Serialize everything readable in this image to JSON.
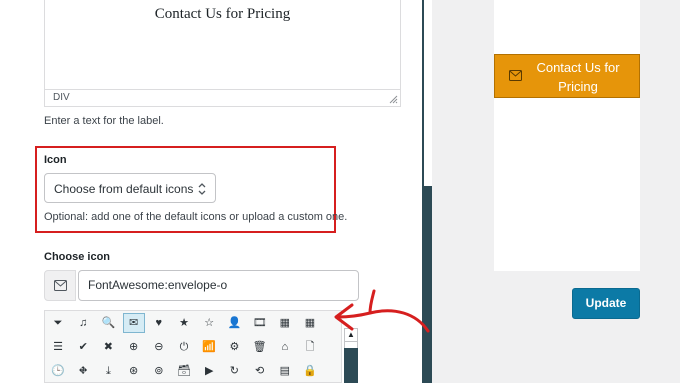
{
  "label_preview": {
    "text": "Contact Us for Pricing",
    "element_path": "DIV"
  },
  "label_help": "Enter a text for the label.",
  "icon_section": {
    "title": "Icon",
    "select_value": "Choose from default icons",
    "help": "Optional: add one of the default icons or upload a custom one."
  },
  "choose_icon": {
    "title": "Choose icon",
    "input_value": "FontAwesome:envelope-o",
    "prefix_icon": "envelope-o-icon"
  },
  "icon_grid": {
    "rows": [
      [
        "filter",
        "music",
        "search",
        "envelope-o",
        "heart",
        "star",
        "star-o",
        "user",
        "film",
        "th-large",
        "th"
      ],
      [
        "th-list",
        "check",
        "times",
        "search-plus",
        "search-minus",
        "power-off",
        "signal",
        "cog",
        "trash-o",
        "home",
        "file-o"
      ],
      [
        "clock-o",
        "road",
        "download",
        "arrow-circle-o-down",
        "arrow-circle-o-up",
        "inbox",
        "play-circle-o",
        "repeat",
        "refresh",
        "list-alt",
        "lock"
      ]
    ],
    "glyphs": [
      [
        "⏷",
        "♫",
        "🔍",
        "✉",
        "♥",
        "★",
        "☆",
        "👤",
        "🎞",
        "▦",
        "▦"
      ],
      [
        "☰",
        "✔",
        "✖",
        "⊕",
        "⊖",
        "⏻",
        "📶",
        "⚙",
        "🗑",
        "⌂",
        "🗋"
      ],
      [
        "🕒",
        "⛖",
        "⤓",
        "⊛",
        "⊚",
        "🗃",
        "▶",
        "↻",
        "⟲",
        "▤",
        "🔒"
      ]
    ],
    "selected": "envelope-o"
  },
  "preview": {
    "button_text": "Contact Us for Pricing",
    "button_icon": "envelope-o-icon"
  },
  "update_label": "Update",
  "colors": {
    "accent": "#e6950a",
    "primary": "#0c7aa6",
    "highlight": "#d61f1f",
    "scroll": "#2c4a55"
  }
}
